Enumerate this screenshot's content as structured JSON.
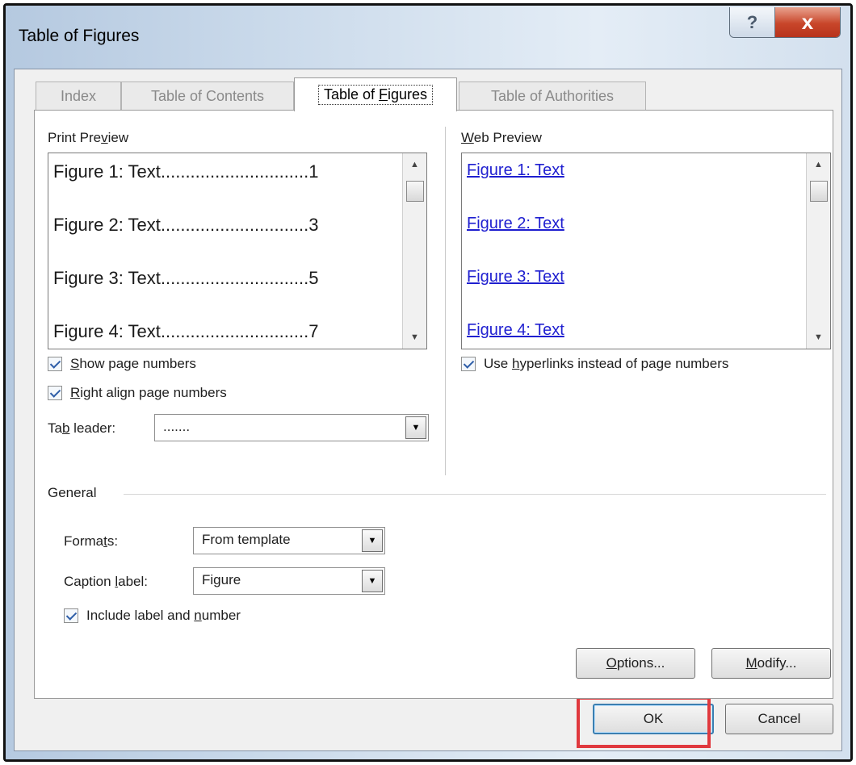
{
  "window": {
    "title": "Table of Figures",
    "help_glyph": "?",
    "close_glyph": "x"
  },
  "tabs": [
    {
      "label": "Index"
    },
    {
      "label": "Table of Contents"
    },
    {
      "pre": "Table of ",
      "key": "F",
      "post": "igures",
      "active": true
    },
    {
      "label": "Table of Authorities"
    }
  ],
  "print_preview": {
    "label_pre": "Print Pre",
    "label_key": "v",
    "label_post": "iew",
    "items": [
      "Figure 1: Text..............................1",
      "Figure 2: Text..............................3",
      "Figure 3: Text..............................5",
      "Figure 4: Text..............................7"
    ],
    "scroll_up": "▲",
    "scroll_down": "▼"
  },
  "web_preview": {
    "label_key": "W",
    "label_post": "eb Preview",
    "items": [
      "Figure 1: Text",
      "Figure 2: Text",
      "Figure 3: Text",
      "Figure 4: Text"
    ],
    "scroll_up": "▲",
    "scroll_down": "▼"
  },
  "options": {
    "show_page_numbers": {
      "key": "S",
      "post": "how page numbers",
      "checked": true
    },
    "right_align": {
      "key": "R",
      "post": "ight align page numbers",
      "checked": true
    },
    "tab_leader": {
      "pre": "Ta",
      "key": "b",
      "post": " leader:",
      "value": ".......",
      "arrow": "▼"
    },
    "use_hyperlinks": {
      "pre": "Use ",
      "key": "h",
      "post": "yperlinks instead of page numbers",
      "checked": true
    }
  },
  "general": {
    "heading": "General",
    "formats": {
      "pre": "Forma",
      "key": "t",
      "post": "s:",
      "value": "From template",
      "arrow": "▼"
    },
    "caption": {
      "pre": "Caption ",
      "key": "l",
      "post": "abel:",
      "value": "Figure",
      "arrow": "▼"
    },
    "include": {
      "pre": "Include label and ",
      "key": "n",
      "post": "umber",
      "checked": true
    }
  },
  "buttons": {
    "options": {
      "key": "O",
      "post": "ptions..."
    },
    "modify": {
      "key": "M",
      "post": "odify..."
    },
    "ok": "OK",
    "cancel": "Cancel"
  },
  "colors": {
    "accent_highlight": "#e0393e",
    "link": "#1f1fd0",
    "check": "#2f5ea8"
  }
}
